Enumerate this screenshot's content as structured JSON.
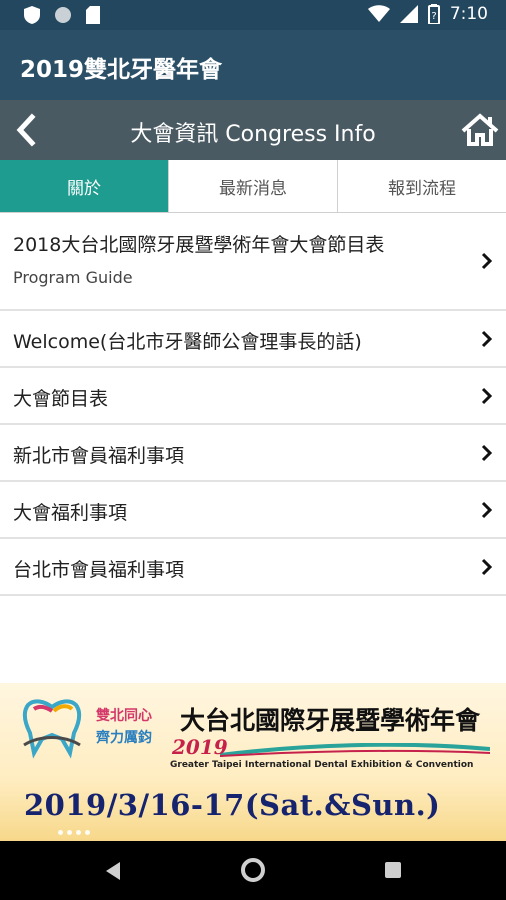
{
  "status_bar": {
    "time": "7:10",
    "icons": [
      "shield-icon",
      "circle-icon",
      "sd-card-icon",
      "wifi-icon",
      "signal-icon",
      "battery-icon"
    ]
  },
  "app_bar": {
    "title": "2019雙北牙醫年會"
  },
  "sub_header": {
    "title": "大會資訊 Congress Info",
    "back_icon": "chevron-left-icon",
    "home_icon": "home-icon"
  },
  "tabs": [
    {
      "label": "關於",
      "active": true
    },
    {
      "label": "最新消息",
      "active": false
    },
    {
      "label": "報到流程",
      "active": false
    }
  ],
  "list": [
    {
      "title": "2018大台北國際牙展暨學術年會大會節目表",
      "subtitle": "Program Guide"
    },
    {
      "title": "Welcome(台北市牙醫師公會理事長的話)"
    },
    {
      "title": "大會節目表"
    },
    {
      "title": "新北市會員福利事項"
    },
    {
      "title": "大會福利事項"
    },
    {
      "title": "台北市會員福利事項"
    }
  ],
  "banner": {
    "slogan_line1": "雙北同心",
    "slogan_line2": "齊力厲鈞",
    "title": "大台北國際牙展暨學術年會",
    "year": "2019",
    "subtitle_en": "Greater Taipei International Dental Exhibition & Convention",
    "date": "2019/3/16-17(Sat.&Sun.)"
  },
  "colors": {
    "status_bar": "#22475e",
    "app_bar": "#2a4f66",
    "sub_header": "#4a5a63",
    "tab_active": "#1f9c90",
    "date_text": "#16236e"
  }
}
